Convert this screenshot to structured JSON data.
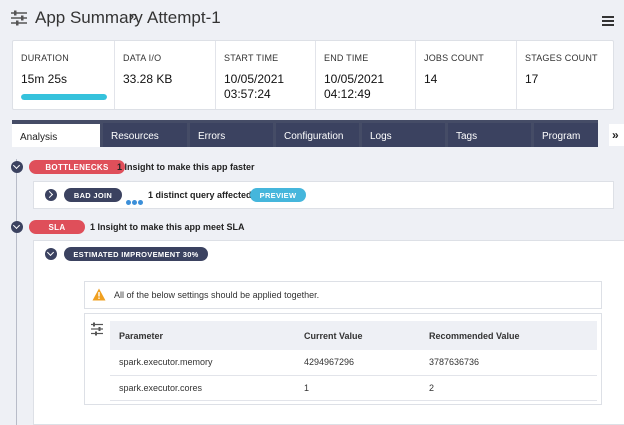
{
  "header": {
    "title": "App Summary",
    "separator": "»",
    "subtitle": "Attempt-1"
  },
  "stats": [
    {
      "label": "DURATION",
      "value": "15m 25s"
    },
    {
      "label": "DATA I/O",
      "value": "33.28 KB"
    },
    {
      "label": "START TIME",
      "value": "10/05/2021\n03:57:24"
    },
    {
      "label": "END TIME",
      "value": "10/05/2021\n04:12:49"
    },
    {
      "label": "JOBS COUNT",
      "value": "14"
    },
    {
      "label": "STAGES COUNT",
      "value": "17"
    }
  ],
  "duration_progress_percent": 100,
  "colors": {
    "accent_cyan": "#35c2dc",
    "tag_red": "#df4f5a",
    "tag_dark": "#3b4260",
    "preview_blue": "#45b6dc",
    "warning_orange": "#f0a020"
  },
  "tabs": [
    {
      "label": "Analysis",
      "active": true
    },
    {
      "label": "Resources",
      "active": false
    },
    {
      "label": "Errors",
      "active": false
    },
    {
      "label": "Configuration",
      "active": false
    },
    {
      "label": "Logs",
      "active": false
    },
    {
      "label": "Tags",
      "active": false
    },
    {
      "label": "Program",
      "active": false
    }
  ],
  "tabs_more": "»",
  "bottlenecks": {
    "tag": "BOTTLENECKS",
    "text": "1 Insight to make this app faster",
    "item": {
      "tag": "BAD JOIN",
      "text": "1 distinct query affected",
      "preview": "PREVIEW"
    }
  },
  "sla": {
    "tag": "SLA",
    "text": "1 Insight to make this app meet SLA",
    "improvement": "ESTIMATED IMPROVEMENT 30%",
    "warning": "All of the below settings should be applied together.",
    "table": {
      "columns": [
        "Parameter",
        "Current Value",
        "Recommended Value"
      ],
      "rows": [
        [
          "spark.executor.memory",
          "4294967296",
          "3787636736"
        ],
        [
          "spark.executor.cores",
          "1",
          "2"
        ]
      ]
    }
  },
  "icons": {
    "header": "settings-sliders-icon",
    "menu": "hamburger-menu-icon",
    "warning": "warning-triangle-icon",
    "table": "settings-sliders-icon"
  }
}
